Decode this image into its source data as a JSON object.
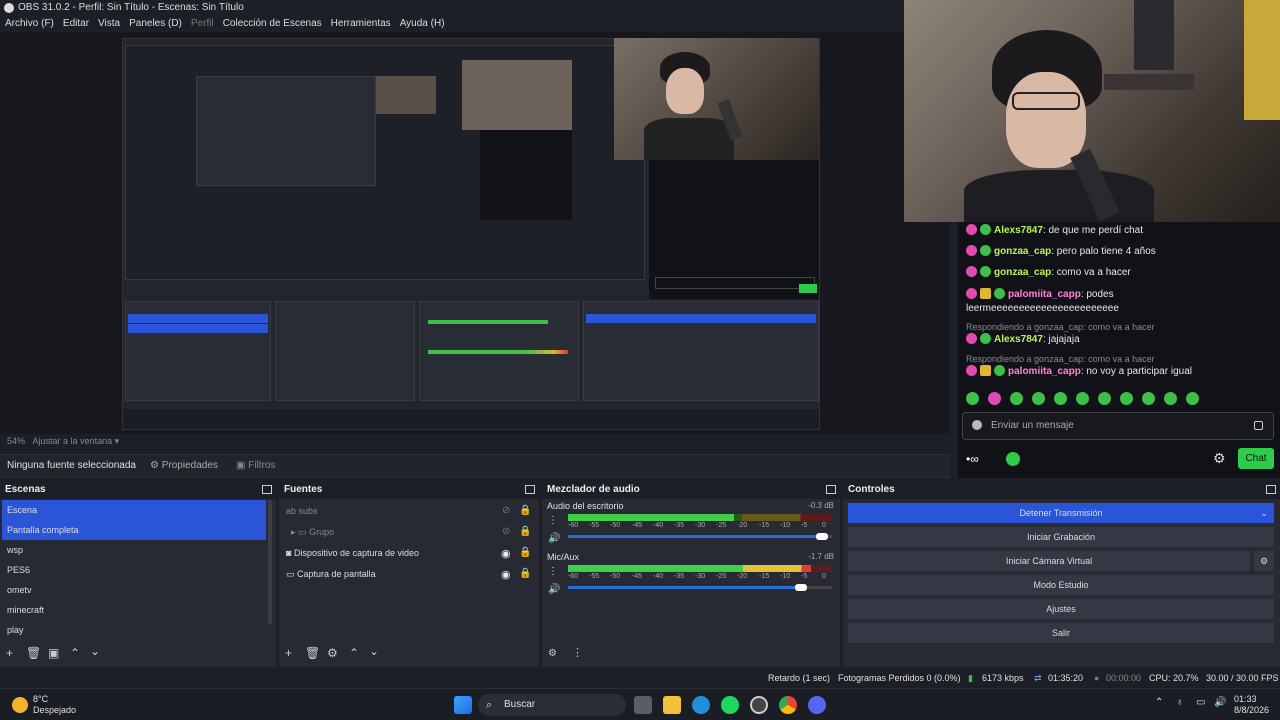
{
  "window": {
    "title": "OBS 31.0.2 - Perfil: Sin Título - Escenas: Sin Título"
  },
  "menu": [
    "Archivo (F)",
    "Editar",
    "Vista",
    "Paneles (D)",
    "Perfil",
    "Colección de Escenas",
    "Herramientas",
    "Ayuda (H)"
  ],
  "preview": {
    "zoom_label": "54%",
    "fit_label": "Ajustar a la ventana"
  },
  "source_bar": {
    "no_source": "Ninguna fuente seleccionada",
    "properties": "Propiedades",
    "filters": "Filtros"
  },
  "scenes": {
    "title": "Escenas",
    "items": [
      "Escena",
      "Pantalla completa",
      "wsp",
      "PES6",
      "ometv",
      "minecraft",
      "play"
    ]
  },
  "sources": {
    "title": "Fuentes",
    "items": [
      "subs",
      "Grupo",
      "Dispositivo de captura de video",
      "Captura de pantalla"
    ]
  },
  "mixer": {
    "title": "Mezclador de audio",
    "channels": [
      {
        "name": "Audio del escritorio",
        "db": "-0.3 dB",
        "level": 0.63,
        "volume": 1.0
      },
      {
        "name": "Mic/Aux",
        "db": "-1.7 dB",
        "level": 0.92,
        "volume": 0.92
      }
    ],
    "ticks": [
      "-60",
      "-55",
      "-50",
      "-45",
      "-40",
      "-35",
      "-30",
      "-25",
      "-20",
      "-15",
      "-10",
      "-5",
      "0"
    ]
  },
  "controls": {
    "title": "Controles",
    "buttons": [
      "Detener Transmisión",
      "Iniciar Grabación",
      "Iniciar Cámara Virtual",
      "Modo Estudio",
      "Ajustes",
      "Salir"
    ]
  },
  "status": {
    "delay": "Retardo (1 sec)",
    "dropped": "Fotogramas Perdidos 0 (0.0%)",
    "kbps": "6173 kbps",
    "stream_time": "01:35:20",
    "rec_time": "00:00:00",
    "cpu": "CPU: 20.7%",
    "fps": "30.00 / 30.00 FPS"
  },
  "chat": {
    "messages": [
      {
        "user": "Alexs7847",
        "text": ": de que me perdí chat",
        "color": "green"
      },
      {
        "user": "gonzaa_cap",
        "text": ": pero palo tiene 4 años",
        "color": "green"
      },
      {
        "user": "gonzaa_cap",
        "text": ": como va a hacer",
        "color": "green"
      },
      {
        "user": "palomiita_capp",
        "text": ": podes",
        "color": "pink"
      },
      {
        "user": "",
        "text": "leermeeeeeeeeeeeeeeeeeeeeeee",
        "color": "plain"
      },
      {
        "user": "",
        "text": "Respondiendo a gonzaa_cap: como va a hacer",
        "color": "reply"
      },
      {
        "user": "Alexs7847",
        "text": ": jajajaja",
        "color": "green"
      },
      {
        "user": "",
        "text": "Respondiendo a gonzaa_cap: como va a hacer",
        "color": "reply"
      },
      {
        "user": "palomiita_capp",
        "text": ": no voy a participar igual",
        "color": "pink"
      }
    ],
    "input_placeholder": "Enviar un mensaje",
    "chat_button": "Chat"
  },
  "taskbar": {
    "weather_temp": "8°C",
    "weather_desc": "Despejado",
    "search": "Buscar",
    "time": "01:33",
    "date": "8/8/2026"
  },
  "colors": {
    "accent": "#2b55d9",
    "chat_green": "#2ecc4a"
  }
}
